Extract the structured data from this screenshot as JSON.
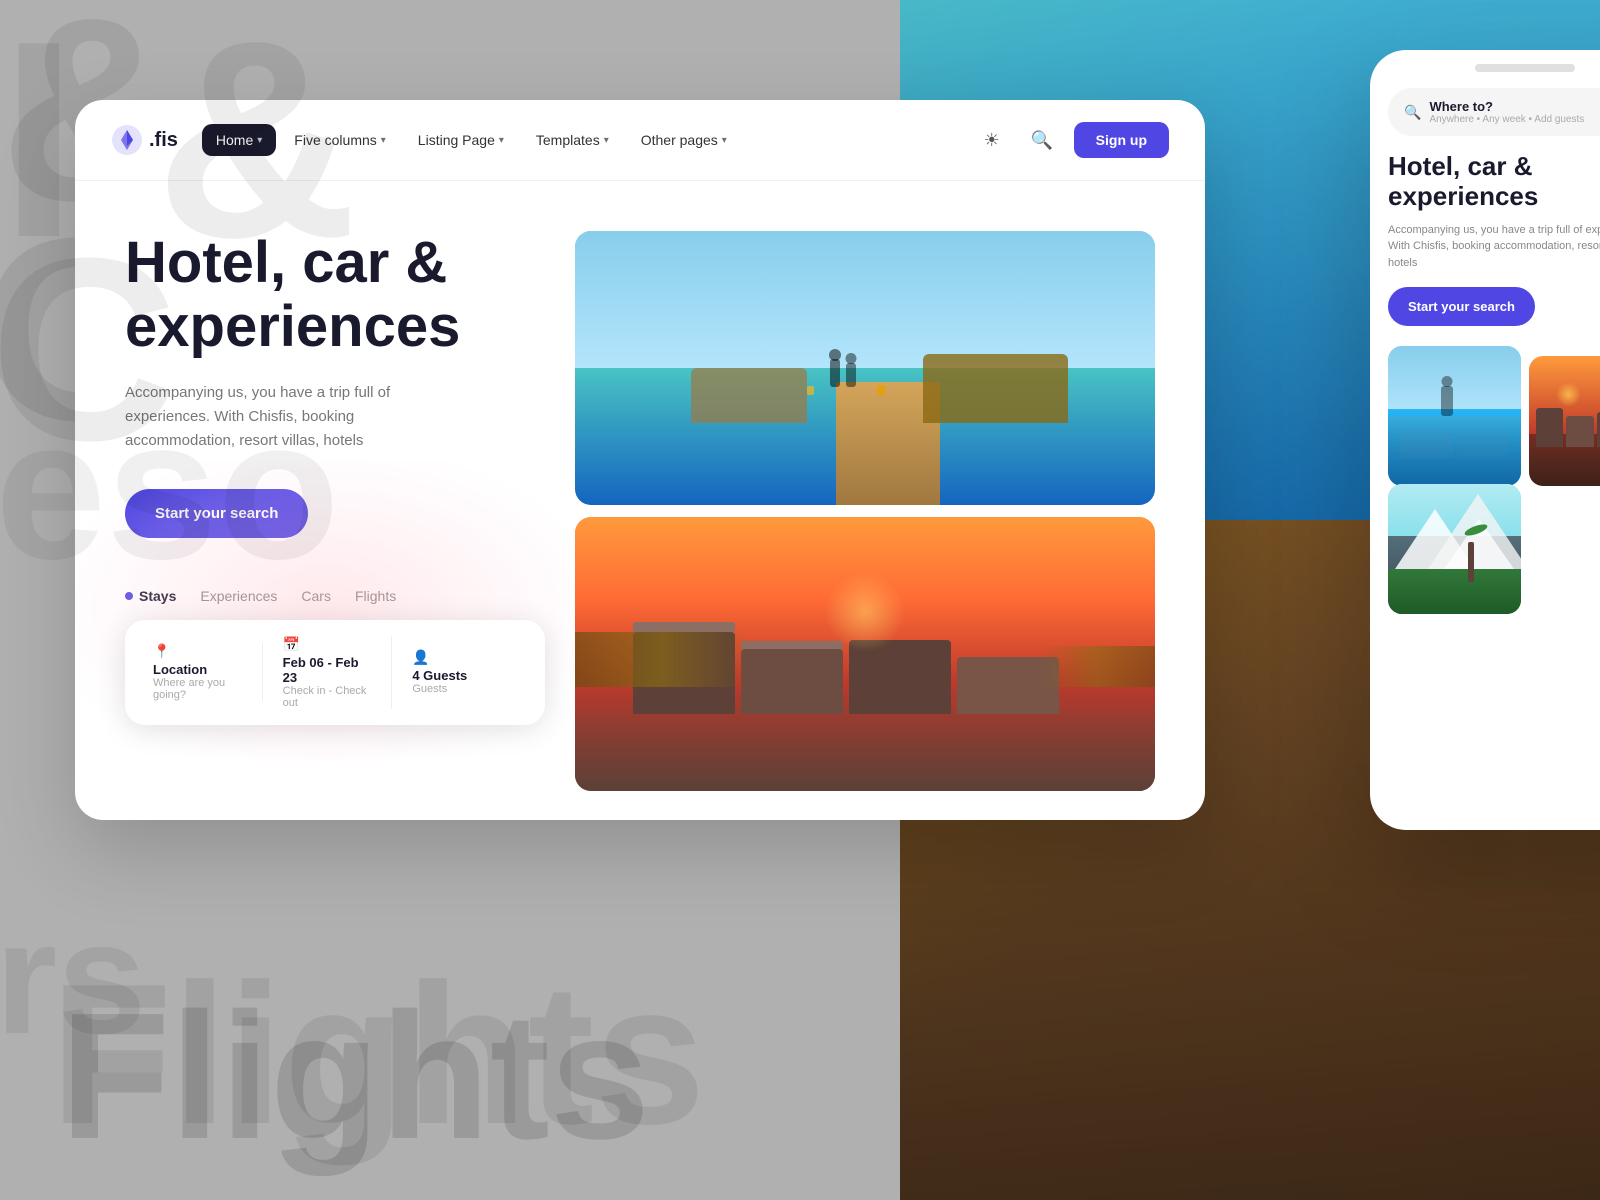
{
  "background": {
    "text_tl": "& ",
    "text_cl": "C",
    "text_cr": "eso",
    "text_bl_partial": "rs",
    "flights_text": "Flights"
  },
  "navbar": {
    "logo_text": ".fis",
    "nav_items": [
      {
        "label": "Home",
        "active": true
      },
      {
        "label": "Five columns",
        "active": false
      },
      {
        "label": "Listing Page",
        "active": false
      },
      {
        "label": "Templates",
        "active": false
      },
      {
        "label": "Other pages",
        "active": false
      }
    ],
    "signup_label": "Sign up"
  },
  "hero": {
    "title": "Hotel, car & experiences",
    "subtitle": "Accompanying us, you have a trip full of experiences. With Chisfis, booking accommodation, resort villas, hotels",
    "cta_label": "Start your search",
    "search_tabs": [
      {
        "label": "Stays",
        "active": true
      },
      {
        "label": "Experiences",
        "active": false
      },
      {
        "label": "Cars",
        "active": false
      },
      {
        "label": "Flights",
        "active": false
      }
    ]
  },
  "search_bar": {
    "location_label": "Location",
    "location_placeholder": "Where are you going?",
    "date_label": "Feb 06 - Feb 23",
    "date_sub": "Check in - Check out",
    "guests_label": "4 Guests",
    "guests_sub": "Guests"
  },
  "phone": {
    "search_title": "Where to?",
    "search_sub": "Anywhere • Any week • Add guests",
    "hero_title": "Hotel, car & experiences",
    "hero_subtitle": "Accompanying us, you have a trip full of experiences. With Chisfis, booking accommodation, resort villas, hotels",
    "cta_label": "Start your search"
  }
}
